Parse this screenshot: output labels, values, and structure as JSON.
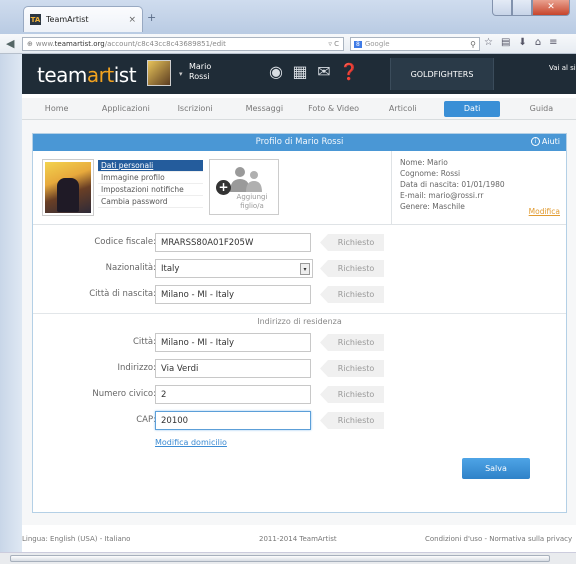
{
  "browser": {
    "tab_title": "TeamArtist",
    "tab_close": "×",
    "new_tab": "+",
    "favicon_letter": "TA",
    "url_domain": "www.teamartist.org",
    "url_path": "/account/c8c43cc8c43689851/edit",
    "url_prefix": "www.",
    "url_host": "teamartist.org",
    "url_icons": "▿ C",
    "search_engine_badge": "8",
    "search_placeholder": "Google",
    "toolbar_icons": [
      "search-icon",
      "star-icon",
      "bookmark-icon",
      "download-icon",
      "home-icon",
      "menu-icon"
    ]
  },
  "app": {
    "logo_left": "team",
    "logo_accent": "art",
    "logo_right": "ist",
    "user_first": "Mario",
    "user_last": "Rossi",
    "team_name": "GOLDFIGHTERS",
    "goto_text": "Vai al si",
    "header_icons": [
      "palette-icon",
      "calendar-icon",
      "mail-icon",
      "help-icon"
    ]
  },
  "main_tabs": [
    {
      "label": "Home",
      "active": false
    },
    {
      "label": "Applicazioni",
      "active": false
    },
    {
      "label": "Iscrizioni",
      "active": false
    },
    {
      "label": "Messaggi",
      "active": false
    },
    {
      "label": "Foto & Video",
      "active": false
    },
    {
      "label": "Articoli",
      "active": false
    },
    {
      "label": "Dati",
      "active": true
    },
    {
      "label": "Guida",
      "active": false
    }
  ],
  "profile": {
    "title": "Profilo di Mario Rossi",
    "help": "Aiuti",
    "submenu": [
      {
        "label": "Dati personali",
        "active": true
      },
      {
        "label": "Immagine profilo",
        "active": false
      },
      {
        "label": "Impostazioni notifiche",
        "active": false
      },
      {
        "label": "Cambia password",
        "active": false
      }
    ],
    "add_child_line1": "Aggiungi",
    "add_child_line2": "figlio/a",
    "info": {
      "name": "Nome: Mario",
      "surname": "Cognome: Rossi",
      "birthdate": "Data di nascita: 01/01/1980",
      "email": "E-mail: mario@rossi.rr",
      "gender": "Genere: Maschile",
      "edit": "Modifica"
    }
  },
  "form": {
    "required_label": "Richiesto",
    "tax_code_label": "Codice fiscale:",
    "tax_code_value": "MRARSS80A01F205W",
    "nationality_label": "Nazionalità:",
    "nationality_value": "Italy",
    "birth_city_label": "Città di nascita:",
    "birth_city_value": "Milano - MI - Italy",
    "residence_heading": "Indirizzo di residenza",
    "city_label": "Città:",
    "city_value": "Milano - MI - Italy",
    "address_label": "Indirizzo:",
    "address_value": "Via Verdi",
    "number_label": "Numero civico:",
    "number_value": "2",
    "cap_label": "CAP:",
    "cap_value": "20100",
    "change_address": "Modifica domicilio",
    "save": "Salva"
  },
  "footer": {
    "language": "Lingua: English (USA) - Italiano",
    "copyright": "2011-2014 TeamArtist",
    "terms": "Condizioni d'uso - Normativa sulla privacy"
  }
}
